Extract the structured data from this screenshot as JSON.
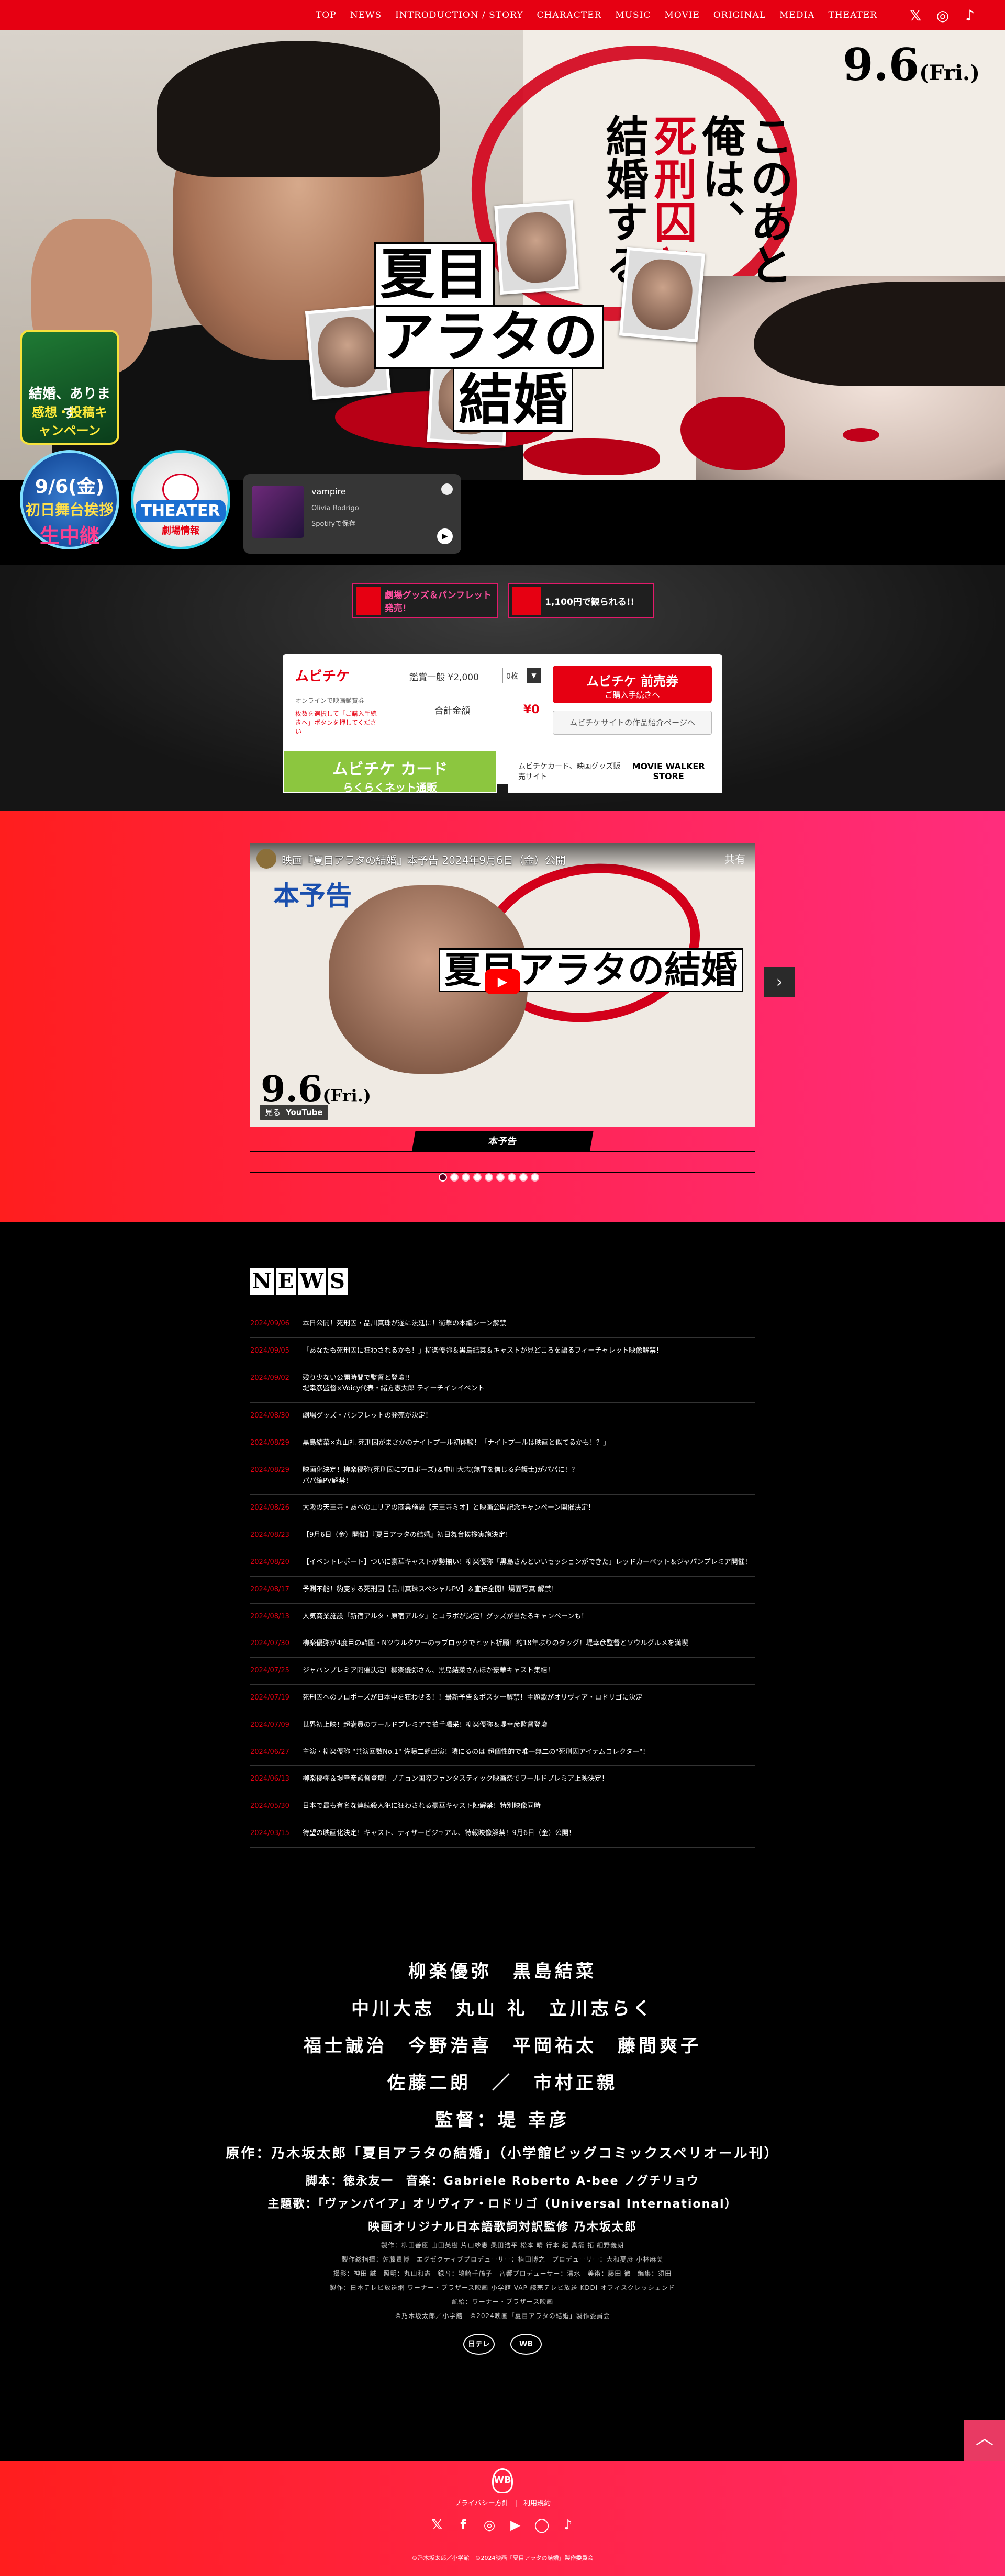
{
  "nav": {
    "items": [
      "TOP",
      "NEWS",
      "INTRODUCTION / STORY",
      "CHARACTER",
      "MUSIC",
      "MOVIE",
      "ORIGINAL",
      "MEDIA",
      "THEATER"
    ],
    "icons": [
      "x-icon",
      "instagram-icon",
      "tiktok-icon"
    ]
  },
  "hero": {
    "date": "9.6",
    "date_day": "(Fri.)",
    "tagline": [
      "このあと",
      "俺は、",
      "死刑囚と",
      "結婚する。"
    ],
    "title": [
      "夏目",
      "アラタの",
      "結婚"
    ]
  },
  "campaign": {
    "badge_a_label": "結婚、あります",
    "badge_a_sub": "感想・投稿キャンペーン",
    "badge_b_date": "9/6(金)",
    "badge_b_title": "初日舞台挨拶",
    "badge_b_sub": "生中継",
    "badge_c_title": "THEATER",
    "badge_c_sub": "劇場情報"
  },
  "spotify": {
    "track": "vampire",
    "artist": "Olivia Rodrigo",
    "save": "Spotifyで保存",
    "play": "▶"
  },
  "banners": [
    {
      "label": "劇場グッズ＆パンフレット発売!"
    },
    {
      "label": "1,100円で観られる!!"
    }
  ],
  "ticket": {
    "brand": "ムビチケ",
    "sub1": "オンラインで映画鑑賞券",
    "sub2": "枚数を選択して「ご購入手続きへ」ボタンを押してください",
    "price_label": "鑑賞一般 ¥2,000",
    "qty": "0枚",
    "total_label": "合計金額",
    "total": "¥0",
    "buy_line1": "ムビチケ 前売券",
    "buy_line2": "ご購入手続きへ",
    "more": "ムビチケサイトの作品紹介ページへ",
    "green_line1": "ムビチケ カード",
    "green_line2": "らくらくネット通販",
    "white_line1": "ムビチケカード、映画グッズ販売サイト",
    "white_line2": "MOVIE WALKER STORE"
  },
  "trailer": {
    "video_title": "映画『夏目アラタの結婚』本予告 2024年9月6日（金）公開",
    "badge": "本予告",
    "video_heading": "夏目アラタの結婚",
    "video_date": "9.6",
    "video_date_day": "(Fri.)",
    "watch": "見る",
    "youtube": "YouTube",
    "share": "共有",
    "play": "▶",
    "next": "›",
    "label": "本予告",
    "dots": 9,
    "active_dot": 0
  },
  "news": {
    "heading": [
      "N",
      "E",
      "W",
      "S"
    ],
    "items": [
      {
        "date": "2024/09/06",
        "text": "本日公開！死刑囚・品川真珠が遂に法廷に！衝撃の本編シーン解禁"
      },
      {
        "date": "2024/09/05",
        "text": "「あなたも死刑囚に狂わされるかも！」柳楽優弥＆黒島結菜＆キャストが見どころを語るフィーチャレット映像解禁！"
      },
      {
        "date": "2024/09/02",
        "text": "残り少ない公開時間で監督と登壇!!\n堤幸彦監督×Voicy代表・緒方憲太郎 ティーチインイベント"
      },
      {
        "date": "2024/08/30",
        "text": "劇場グッズ・パンフレットの発売が決定！"
      },
      {
        "date": "2024/08/29",
        "text": "黒島結菜×丸山礼 死刑囚がまさかのナイトプール初体験！「ナイトプールは映画と似てるかも！？」"
      },
      {
        "date": "2024/08/29",
        "text": "映画化決定！柳楽優弥(死刑囚にプロポーズ)＆中川大志(無罪を信じる弁護士)がパパに！？\nパパ編PV解禁！"
      },
      {
        "date": "2024/08/26",
        "text": "大阪の天王寺・あべのエリアの商業施設【天王寺ミオ】と映画公開記念キャンペーン開催決定！"
      },
      {
        "date": "2024/08/23",
        "text": "【9月6日（金）開催】『夏目アラタの結婚』初日舞台挨拶実施決定！"
      },
      {
        "date": "2024/08/20",
        "text": "【イベントレポート】ついに豪華キャストが勢揃い！柳楽優弥「黒島さんといいセッションができた」レッドカーペット＆ジャパンプレミア開催！"
      },
      {
        "date": "2024/08/17",
        "text": "予測不能！豹変する死刑囚【品川真珠スペシャルPV】＆宣伝全開！場面写真 解禁！"
      },
      {
        "date": "2024/08/13",
        "text": "人気商業施設「新宿アルタ・原宿アルタ」とコラボが決定！グッズが当たるキャンペーンも！"
      },
      {
        "date": "2024/07/30",
        "text": "柳楽優弥が4度目の韓国・Nツウルタワーのラブロックでヒット祈願！約18年ぶりのタッグ！堤幸彦監督とソウルグルメを満喫"
      },
      {
        "date": "2024/07/25",
        "text": "ジャパンプレミア開催決定！柳楽優弥さん、黒島結菜さんほか豪華キャスト集結！"
      },
      {
        "date": "2024/07/19",
        "text": "死刑囚へのプロポーズが日本中を狂わせる！！最新予告＆ポスター解禁！主題歌がオリヴィア・ロドリゴに決定"
      },
      {
        "date": "2024/07/09",
        "text": "世界初上映！超満員のワールドプレミアで拍手喝采！柳楽優弥＆堤幸彦監督登壇"
      },
      {
        "date": "2024/06/27",
        "text": "主演・柳楽優弥 \"共演回数No.1\" 佐藤二朗出演！隣にるのは 超個性的で唯一無二の\"死刑囚アイテムコレクター\"！"
      },
      {
        "date": "2024/06/13",
        "text": "柳楽優弥＆堤幸彦監督登壇！ブチョン国際ファンタスティック映画祭でワールドプレミア上映決定！"
      },
      {
        "date": "2024/05/30",
        "text": "日本で最も有名な連続殺人犯に狂わされる豪華キャスト陣解禁！特別映像同時"
      },
      {
        "date": "2024/03/15",
        "text": "待望の映画化決定！キャスト、ティザービジュアル、特報映像解禁！9月6日（金）公開！"
      }
    ]
  },
  "credits": {
    "cast_line1": "柳楽優弥　黒島結菜",
    "cast_line2": "中川大志　丸山 礼　立川志らく",
    "cast_line3": "福士誠治　今野浩喜　平岡祐太　藤間爽子",
    "cast_line4": "佐藤二朗　／　市村正親",
    "director": "監督：堤 幸彦",
    "original": "原作：乃木坂太郎「夏目アラタの結婚」（小学館ビッグコミックスペリオール刊）",
    "screenplay": "脚本：徳永友一　音楽：Gabriele Roberto A-bee ノグチリョウ",
    "theme": "主題歌：「ヴァンパイア」オリヴィア・ロドリゴ（Universal International）",
    "theme2": "映画オリジナル日本語歌詞対訳監修 乃木坂太郎",
    "staff1": "製作：柳田善臣 山田英樹 片山紗恵 桑田浩平 松本 晴 行本 紀 真籠 拓 細野義朗",
    "staff2": "製作総指揮：佐藤貴博　エグゼクティブプロデューサー：植田博之　プロデューサー：大和夏彦 小林麻美",
    "staff3": "撮影：神田 誠　照明：丸山和志　録音：鴇崎千鶴子　音響プロデューサー：清水　美術：藤田 徹　編集：須田",
    "staff4": "製作：日本テレビ放送網 ワーナー・ブラザース映画 小学館 VAP 読売テレビ放送 KDDI オフィスクレッシェンド",
    "staff5": "配給：ワーナー・ブラザース映画",
    "copyright": "©乃木坂太郎／小学館　©2024映画「夏目アラタの結婚」製作委員会",
    "logo1": "日テレ",
    "logo2": "WB"
  },
  "page_top": "︿",
  "footer": {
    "logo": "WB",
    "link1": "プライバシー方針",
    "link2": "利用規約",
    "social": [
      "x-icon",
      "facebook-icon",
      "instagram-icon",
      "youtube-icon",
      "line-icon",
      "tiktok-icon"
    ],
    "social_glyphs": [
      "𝕏",
      "f",
      "◎",
      "▶",
      "◯",
      "♪"
    ],
    "copyright": "©乃木坂太郎／小学館　©2024映画「夏目アラタの結婚」製作委員会"
  }
}
